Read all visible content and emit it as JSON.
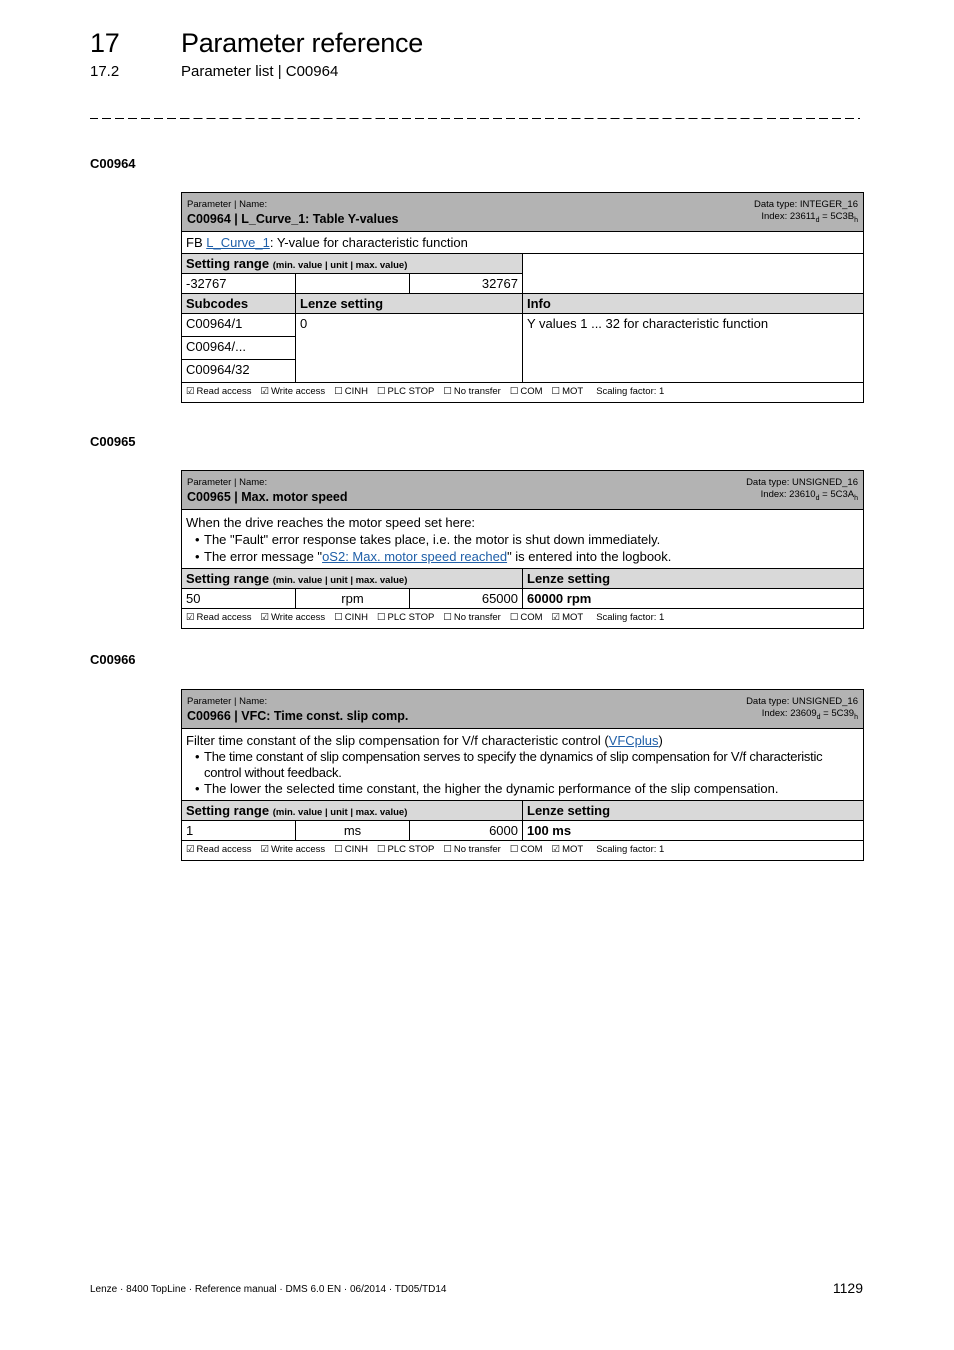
{
  "header": {
    "chapter_number": "17",
    "chapter_title": "Parameter reference",
    "section_number": "17.2",
    "section_title": "Parameter list | C00964"
  },
  "parameters": [
    {
      "heading": "C00964",
      "label": "Parameter | Name:",
      "name": "C00964 | L_Curve_1: Table Y-values",
      "data_type": "Data type: INTEGER_16",
      "index_prefix": "Index: ",
      "index_dec": "23611",
      "index_dec_sub": "d",
      "index_eq": " = ",
      "index_hex": "5C3B",
      "index_hex_sub": "h",
      "description": {
        "prefix": "FB ",
        "link": "L_Curve_1",
        "suffix": ": Y-value for characteristic function"
      },
      "setting_range_label": "Setting range",
      "setting_range_hint": "(min. value | unit | max. value)",
      "range": {
        "min": "-32767",
        "unit": "",
        "max": "32767"
      },
      "subcodes_header": {
        "subcodes": "Subcodes",
        "lenze": "Lenze setting",
        "info": "Info"
      },
      "subcodes": [
        "C00964/1",
        "C00964/...",
        "C00964/32"
      ],
      "subcode_lenze_setting": "0",
      "subcode_info": "Y values 1 ... 32 for characteristic function",
      "flags": [
        {
          "box": "☑",
          "label": "Read access"
        },
        {
          "box": "☑",
          "label": "Write access"
        },
        {
          "box": "☐",
          "label": "CINH"
        },
        {
          "box": "☐",
          "label": "PLC STOP"
        },
        {
          "box": "☐",
          "label": "No transfer"
        },
        {
          "box": "☐",
          "label": "COM"
        },
        {
          "box": "☐",
          "label": "MOT"
        }
      ],
      "scaling": "Scaling factor: 1"
    },
    {
      "heading": "C00965",
      "label": "Parameter | Name:",
      "name": "C00965 | Max. motor speed",
      "data_type": "Data type: UNSIGNED_16",
      "index_prefix": "Index: ",
      "index_dec": "23610",
      "index_dec_sub": "d",
      "index_eq": " = ",
      "index_hex": "5C3A",
      "index_hex_sub": "h",
      "description": {
        "intro": "When the drive reaches the motor speed set here:",
        "bullet1": "The \"Fault\" error response takes place, i.e. the motor is shut down immediately.",
        "bullet2_prefix": "The error message \"",
        "bullet2_link": "oS2: Max. motor speed reached",
        "bullet2_suffix": "\" is entered into the logbook."
      },
      "setting_range_label": "Setting range",
      "setting_range_hint": "(min. value | unit | max. value)",
      "lenze_setting_label": "Lenze setting",
      "range": {
        "min": "50",
        "unit": "rpm",
        "max": "65000"
      },
      "lenze_setting": "60000 rpm",
      "flags": [
        {
          "box": "☑",
          "label": "Read access"
        },
        {
          "box": "☑",
          "label": "Write access"
        },
        {
          "box": "☐",
          "label": "CINH"
        },
        {
          "box": "☐",
          "label": "PLC STOP"
        },
        {
          "box": "☐",
          "label": "No transfer"
        },
        {
          "box": "☐",
          "label": "COM"
        },
        {
          "box": "☑",
          "label": "MOT"
        }
      ],
      "scaling": "Scaling factor: 1"
    },
    {
      "heading": "C00966",
      "label": "Parameter | Name:",
      "name": "C00966 | VFC: Time const. slip comp.",
      "data_type": "Data type: UNSIGNED_16",
      "index_prefix": "Index: ",
      "index_dec": "23609",
      "index_dec_sub": "d",
      "index_eq": " = ",
      "index_hex": "5C39",
      "index_hex_sub": "h",
      "description": {
        "intro_prefix": "Filter time constant of the slip compensation for V/f characteristic control (",
        "intro_link": "VFCplus",
        "intro_suffix": ")",
        "bullet1": "The time constant of slip compensation serves to specify the dynamics of slip compensation for V/f characteristic control without feedback.",
        "bullet2": "The lower the selected time constant, the higher the dynamic performance of the slip compensation."
      },
      "setting_range_label": "Setting range",
      "setting_range_hint": "(min. value | unit | max. value)",
      "lenze_setting_label": "Lenze setting",
      "range": {
        "min": "1",
        "unit": "ms",
        "max": "6000"
      },
      "lenze_setting": "100 ms",
      "flags": [
        {
          "box": "☑",
          "label": "Read access"
        },
        {
          "box": "☑",
          "label": "Write access"
        },
        {
          "box": "☐",
          "label": "CINH"
        },
        {
          "box": "☐",
          "label": "PLC STOP"
        },
        {
          "box": "☐",
          "label": "No transfer"
        },
        {
          "box": "☐",
          "label": "COM"
        },
        {
          "box": "☑",
          "label": "MOT"
        }
      ],
      "scaling": "Scaling factor: 1"
    }
  ],
  "footer": {
    "text": "Lenze · 8400 TopLine · Reference manual · DMS 6.0 EN · 06/2014 · TD05/TD14",
    "page_number": "1129"
  }
}
